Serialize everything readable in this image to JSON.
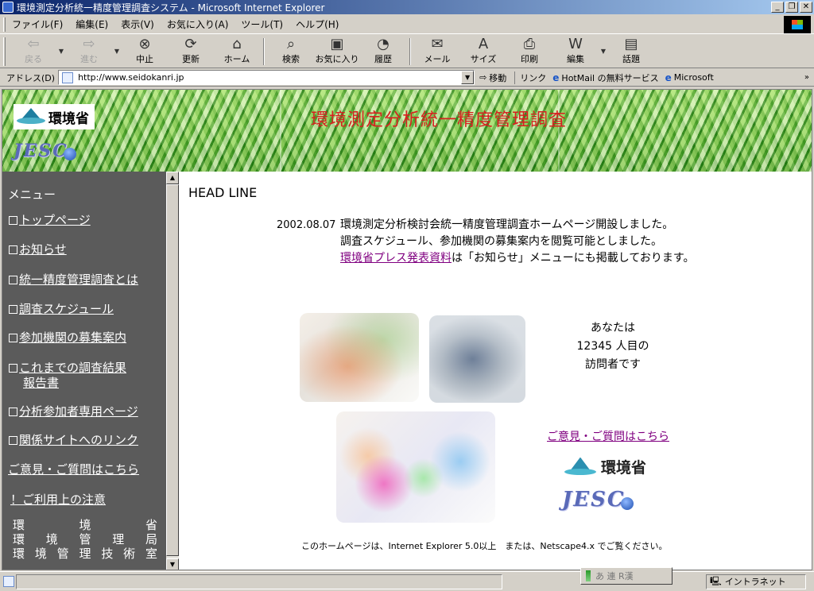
{
  "window": {
    "title": "環境測定分析統一精度管理調査システム - Microsoft Internet Explorer",
    "buttons": [
      "_",
      "❐",
      "✕"
    ]
  },
  "menubar": [
    "ファイル(F)",
    "編集(E)",
    "表示(V)",
    "お気に入り(A)",
    "ツール(T)",
    "ヘルプ(H)"
  ],
  "toolbar": {
    "back": "戻る",
    "forward": "進む",
    "stop": "中止",
    "refresh": "更新",
    "home": "ホーム",
    "search": "検索",
    "favorites": "お気に入り",
    "history": "履歴",
    "mail": "メール",
    "size": "サイズ",
    "print": "印刷",
    "edit": "編集",
    "discuss": "話題"
  },
  "address": {
    "label": "アドレス(D)",
    "url": "http://www.seidokanri.jp",
    "go": "移動",
    "links_label": "リンク",
    "link1": "HotMail の無料サービス",
    "link2": "Microsoft"
  },
  "banner": {
    "ministry_logo_text": "環境省",
    "org_logo_text": "JESC",
    "title": "環境測定分析統一精度管理調査"
  },
  "sidebar": {
    "heading": "メニュー",
    "items": [
      {
        "label": "トップページ",
        "boxed": true
      },
      {
        "label": "お知らせ",
        "boxed": true
      },
      {
        "label": "統一精度管理調査とは",
        "boxed": true
      },
      {
        "label": "調査スケジュール",
        "boxed": true
      },
      {
        "label": "参加機関の募集案内",
        "boxed": true
      },
      {
        "label": "これまでの調査結果",
        "label2": "報告書",
        "boxed": true
      },
      {
        "label": "分析参加者専用ページ",
        "boxed": true
      },
      {
        "label": "関係サイトへのリンク",
        "boxed": true
      },
      {
        "label": "ご意見・ご質問はこちら",
        "boxed": false
      },
      {
        "label": "！ご利用上の注意",
        "boxed": false
      }
    ],
    "org_lines": [
      [
        "環",
        "境",
        "省"
      ],
      [
        "環",
        "境",
        "管",
        "理",
        "局"
      ],
      [
        "環",
        "境",
        "管",
        "理",
        "技",
        "術",
        "室"
      ]
    ]
  },
  "main": {
    "headline_title": "HEAD LINE",
    "news": {
      "date": "2002.08.07",
      "line1": "環境測定分析検討会統一精度管理調査ホームページ開設しました。",
      "line2": "調査スケジュール、参加機関の募集案内を閲覧可能としました。",
      "line3_link": "環境省プレス発表資料",
      "line3_rest": "は「お知らせ」メニューにも掲載しております。"
    },
    "counter": {
      "line1": "あなたは",
      "count": "12345",
      "line2_suffix": " 人目の",
      "line3": "訪問者です"
    },
    "feedback_link": "ご意見・ご質問はこちら",
    "ministry_logo_text": "環境省",
    "org_logo_text": "JESC",
    "footer_note": "このホームページは、Internet Explorer 5.0以上　または、Netscape4.x でご覧ください。"
  },
  "statusbar": {
    "ime_text": "あ 連 R漢",
    "zone": "イントラネット"
  },
  "colors": {
    "title_bar_start": "#0a246a",
    "banner_title": "#d82020",
    "sidebar_bg": "#5b5b5b",
    "visited_link": "#800080"
  }
}
